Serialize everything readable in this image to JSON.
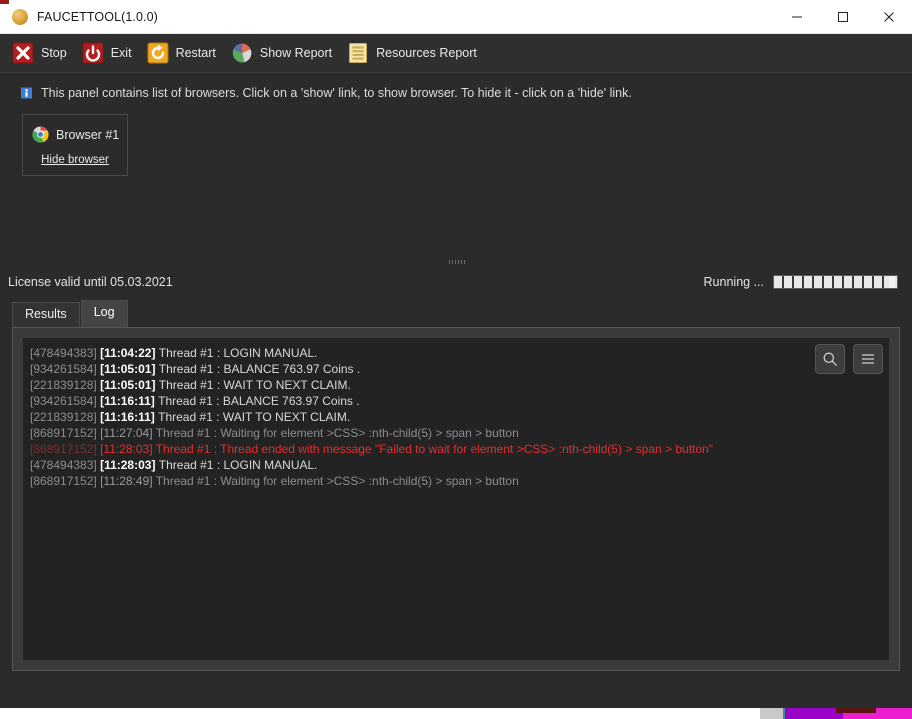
{
  "window": {
    "title": "FAUCETTOOL(1.0.0)",
    "app_icon": "coin-icon",
    "controls": {
      "minimize": "minimize-icon",
      "maximize": "maximize-icon",
      "close": "close-icon"
    }
  },
  "toolbar": {
    "items": [
      {
        "label": "Stop",
        "icon": "stop-x-icon"
      },
      {
        "label": "Exit",
        "icon": "power-icon"
      },
      {
        "label": "Restart",
        "icon": "restart-icon"
      },
      {
        "label": "Show Report",
        "icon": "pie-chart-icon"
      },
      {
        "label": "Resources Report",
        "icon": "list-report-icon"
      }
    ]
  },
  "info": {
    "icon": "info-icon",
    "text": "This panel contains list of browsers. Click on a 'show' link, to show browser. To hide it - click on a 'hide' link."
  },
  "browsers": [
    {
      "name": "Browser #1",
      "icon": "chrome-icon",
      "link_label": "Hide browser"
    }
  ],
  "status": {
    "license": "License valid until 05.03.2021",
    "running_label": "Running ...",
    "progress_percent": 100
  },
  "tabs": [
    {
      "label": "Results",
      "active": false
    },
    {
      "label": "Log",
      "active": true
    }
  ],
  "log": {
    "tools": [
      {
        "icon": "search-icon",
        "name": "log-search-button"
      },
      {
        "icon": "menu-icon",
        "name": "log-menu-button"
      }
    ],
    "lines": [
      {
        "id": "[478494383]",
        "time": "[11:04:22]",
        "message": "Thread #1 : LOGIN MANUAL.",
        "style": "normal"
      },
      {
        "id": "[934261584]",
        "time": "[11:05:01]",
        "message": "Thread #1 : BALANCE 763.97 Coins .",
        "style": "normal"
      },
      {
        "id": "[221839128]",
        "time": "[11:05:01]",
        "message": "Thread #1 : WAIT TO NEXT CLAIM.",
        "style": "normal"
      },
      {
        "id": "[934261584]",
        "time": "[11:16:11]",
        "message": "Thread #1 : BALANCE 763.97 Coins .",
        "style": "normal"
      },
      {
        "id": "[221839128]",
        "time": "[11:16:11]",
        "message": "Thread #1 : WAIT TO NEXT CLAIM.",
        "style": "normal"
      },
      {
        "id": "[868917152]",
        "time": "[11:27:04]",
        "message": "Thread #1 : Waiting for element >CSS> :nth-child(5) > span > button",
        "style": "dim"
      },
      {
        "id": "[868917152]",
        "time": "[11:28:03]",
        "message": "Thread #1 : Thread ended with message \"Failed to wait for element >CSS> :nth-child(5) > span > button\"",
        "style": "error"
      },
      {
        "id": "[478494383]",
        "time": "[11:28:03]",
        "message": "Thread #1 : LOGIN MANUAL.",
        "style": "normal"
      },
      {
        "id": "[868917152]",
        "time": "[11:28:49]",
        "message": "Thread #1 : Waiting for element >CSS> :nth-child(5) > span > button",
        "style": "dim"
      }
    ]
  },
  "colors": {
    "window_bg": "#2b2b2b",
    "toolbar_bg": "#2f2f2f",
    "log_bg": "#232323",
    "error_red": "#e03030",
    "accent_red": "#9b1b1b"
  }
}
